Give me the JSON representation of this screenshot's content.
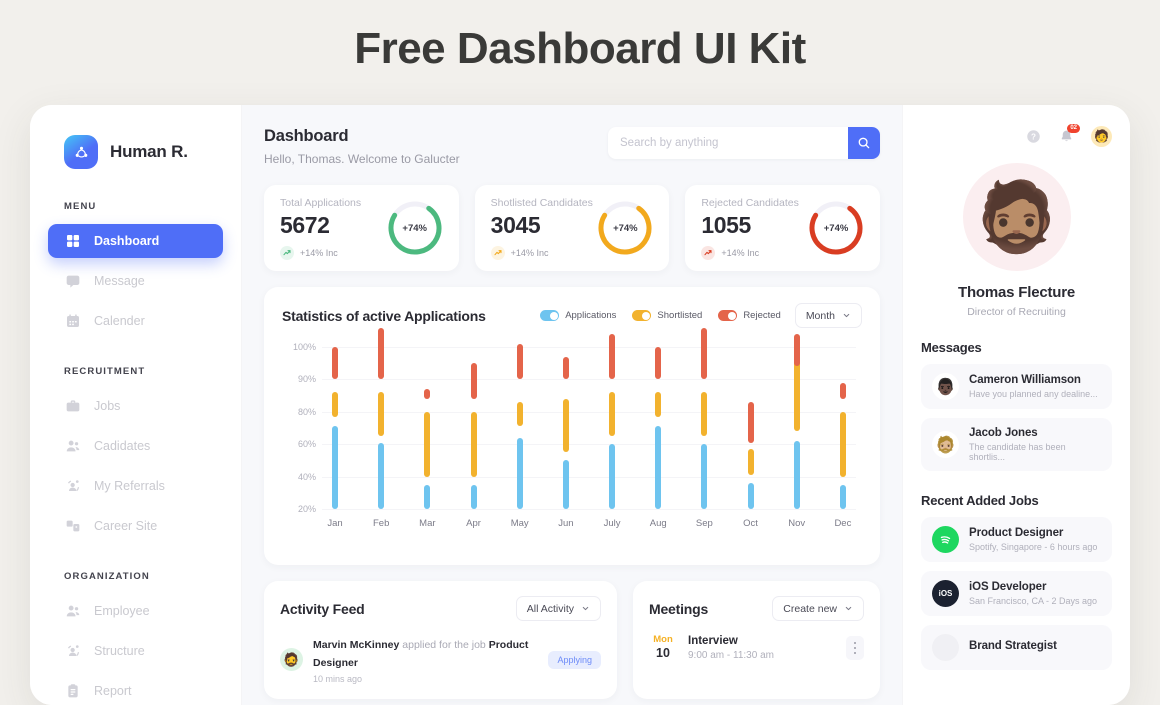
{
  "page_title": "Free Dashboard UI Kit",
  "brand": {
    "name": "Human R.",
    "logo_icon": "share-nodes-icon"
  },
  "sidebar": {
    "sections": [
      {
        "label": "MENU",
        "items": [
          {
            "label": "Dashboard",
            "icon": "grid-icon",
            "active": true
          },
          {
            "label": "Message",
            "icon": "chat-bubble-icon",
            "active": false
          },
          {
            "label": "Calender",
            "icon": "calendar-icon",
            "active": false
          }
        ]
      },
      {
        "label": "RECRUITMENT",
        "items": [
          {
            "label": "Jobs",
            "icon": "briefcase-icon",
            "active": false
          },
          {
            "label": "Cadidates",
            "icon": "users-icon",
            "active": false
          },
          {
            "label": "My Referrals",
            "icon": "referral-icon",
            "active": false
          },
          {
            "label": "Career Site",
            "icon": "windows-icon",
            "active": false
          }
        ]
      },
      {
        "label": "ORGANIZATION",
        "items": [
          {
            "label": "Employee",
            "icon": "users-icon",
            "active": false
          },
          {
            "label": "Structure",
            "icon": "referral-icon",
            "active": false
          },
          {
            "label": "Report",
            "icon": "clipboard-icon",
            "active": false
          }
        ]
      }
    ]
  },
  "header": {
    "title": "Dashboard",
    "subtitle": "Hello, Thomas. Welcome to Galucter",
    "search_placeholder": "Search by anything",
    "search_value": "",
    "search_icon": "search-icon"
  },
  "stats": [
    {
      "label": "Total Applications",
      "value": "5672",
      "delta": "+14% Inc",
      "ring_pct": "+74%",
      "color": "#4cb97f",
      "ring_value": 74,
      "trend_icon": "trend-up-icon"
    },
    {
      "label": "Shotlisted Candidates",
      "value": "3045",
      "delta": "+14% Inc",
      "ring_pct": "+74%",
      "color": "#f2a91d",
      "ring_value": 74,
      "trend_icon": "trend-up-icon"
    },
    {
      "label": "Rejected Candidates",
      "value": "1055",
      "delta": "+14% Inc",
      "ring_pct": "+74%",
      "color": "#d93d22",
      "ring_value": 74,
      "trend_icon": "trend-up-icon"
    }
  ],
  "chart_panel": {
    "title": "Statistics of active Applications",
    "range_label": "Month",
    "range_icon": "chevron-down-icon"
  },
  "chart_data": {
    "type": "bar",
    "title": "Statistics of active Applications",
    "xlabel": "",
    "ylabel": "",
    "ylim": [
      20,
      110
    ],
    "grid": true,
    "legend_position": "top-right",
    "ytick_labels": [
      "100%",
      "90%",
      "80%",
      "60%",
      "40%",
      "20%"
    ],
    "categories": [
      "Jan",
      "Feb",
      "Mar",
      "Apr",
      "May",
      "Jun",
      "July",
      "Aug",
      "Sep",
      "Oct",
      "Nov",
      "Dec"
    ],
    "series": [
      {
        "name": "Applications",
        "color": "#6ec4ef",
        "low": [
          20,
          20,
          20,
          20,
          20,
          20,
          20,
          20,
          20,
          20,
          20,
          20
        ],
        "high": [
          71,
          61,
          35,
          35,
          64,
          50,
          60,
          71,
          60,
          36,
          62,
          35
        ]
      },
      {
        "name": "Shortlisted",
        "color": "#f2b22e",
        "low": [
          77,
          65,
          40,
          40,
          71,
          55,
          65,
          77,
          65,
          41,
          68,
          40
        ],
        "high": [
          86,
          86,
          80,
          80,
          83,
          84,
          86,
          86,
          86,
          57,
          97,
          80
        ]
      },
      {
        "name": "Rejected",
        "color": "#e4644a",
        "low": [
          90,
          90,
          84,
          84,
          90,
          90,
          90,
          90,
          90,
          61,
          94,
          84
        ],
        "high": [
          100,
          106,
          87,
          95,
          101,
          97,
          104,
          100,
          106,
          83,
          104,
          89
        ]
      }
    ]
  },
  "activity": {
    "title": "Activity Feed",
    "filter_label": "All Activity",
    "filter_icon": "chevron-down-icon",
    "rows": [
      {
        "avatar": "🧔",
        "name": "Marvin McKinney",
        "action": "applied for the job",
        "job": "Product Designer",
        "time": "10 mins ago",
        "chip": "Applying"
      }
    ]
  },
  "meetings": {
    "title": "Meetings",
    "action_label": "Create new",
    "action_icon": "chevron-down-icon",
    "rows": [
      {
        "dow": "Mon",
        "day": "10",
        "name": "Interview",
        "time": "9:00 am - 11:30 am",
        "menu_icon": "kebab-menu-icon"
      }
    ]
  },
  "rail": {
    "icons": [
      {
        "name": "help-icon",
        "badge": ""
      },
      {
        "name": "bell-icon",
        "badge": "02"
      }
    ],
    "account_avatar": "🧑",
    "profile": {
      "avatar": "🧔🏽",
      "name": "Thomas Flecture",
      "role": "Director of Recruiting"
    },
    "messages_title": "Messages",
    "messages": [
      {
        "avatar": "👨🏿",
        "name": "Cameron Williamson",
        "preview": "Have you planned any dealine..."
      },
      {
        "avatar": "🧔🏼",
        "name": "Jacob Jones",
        "preview": "The candidate has been shortlis..."
      }
    ],
    "jobs_title": "Recent Added Jobs",
    "jobs": [
      {
        "icon": "spotify-icon",
        "icon_text": "",
        "icon_bg": "#1ed760",
        "title": "Product Designer",
        "sub": "Spotify, Singapore  -  6 hours ago"
      },
      {
        "icon": "ios-icon",
        "icon_text": "iOS",
        "icon_bg": "#1b2130",
        "title": "iOS Developer",
        "sub": "San Francisco, CA  -  2 Days ago"
      },
      {
        "icon": "company-icon",
        "icon_text": "",
        "icon_bg": "#f0f0f4",
        "title": "Brand Strategist",
        "sub": ""
      }
    ]
  },
  "colors": {
    "accent": "#4f6ef7",
    "green": "#4cb97f",
    "orange": "#f2a91d",
    "red": "#d93d22"
  }
}
